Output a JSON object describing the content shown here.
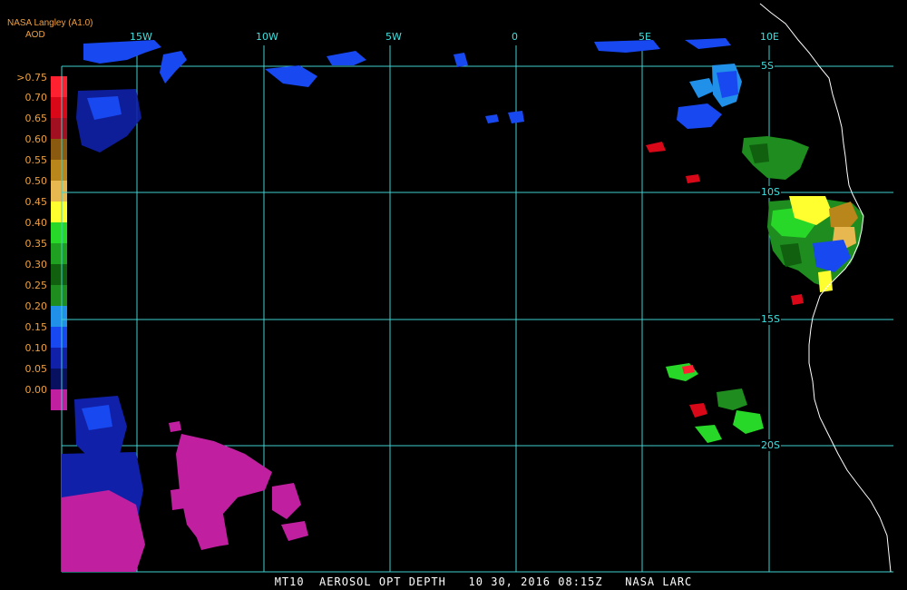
{
  "header": {
    "source": "NASA Langley (A1.0)",
    "product": "AOD"
  },
  "legend": {
    "levels": [
      ">0.75",
      "0.70",
      "0.65",
      "0.60",
      "0.55",
      "0.50",
      "0.45",
      "0.40",
      "0.35",
      "0.30",
      "0.25",
      "0.20",
      "0.15",
      "0.10",
      "0.05",
      "0.00"
    ],
    "colors": [
      "#ff2030",
      "#d80818",
      "#a01020",
      "#8a5a10",
      "#b8861a",
      "#e8b850",
      "#ffff30",
      "#28d828",
      "#20a020",
      "#106010",
      "#1e8c1e",
      "#2090e8",
      "#1848f0",
      "#1020a8",
      "#081060",
      "#c020a0"
    ]
  },
  "grid": {
    "longitudes": [
      "15W",
      "10W",
      "5W",
      "0",
      "5E",
      "10E"
    ],
    "latitudes": [
      "5S",
      "10S",
      "15S",
      "20S"
    ],
    "line_color": "#40d0d0"
  },
  "footer": {
    "caption": "MT10  AEROSOL OPT DEPTH   10 30, 2016 08:15Z   NASA LARC"
  }
}
